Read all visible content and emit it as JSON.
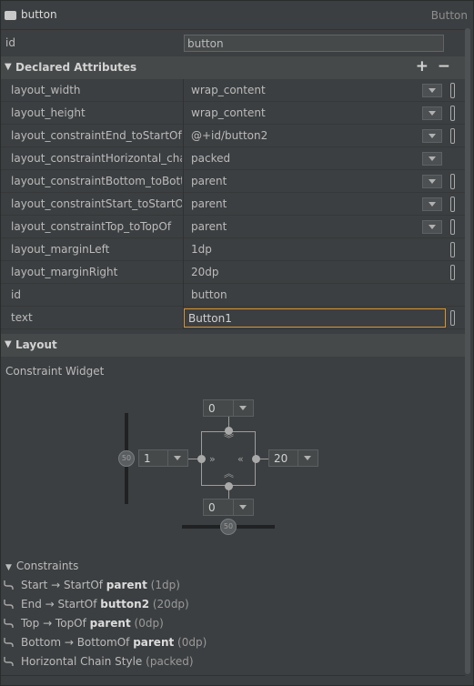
{
  "component": {
    "name": "button",
    "class_name": "Button"
  },
  "id_field": {
    "label": "id",
    "value": "button"
  },
  "declared_attributes": {
    "title": "Declared Attributes",
    "add": "+",
    "remove": "−",
    "rows": [
      {
        "name": "layout_width",
        "value": "wrap_content"
      },
      {
        "name": "layout_height",
        "value": "wrap_content"
      },
      {
        "name": "layout_constraintEnd_toStartOf",
        "value": "@+id/button2"
      },
      {
        "name": "layout_constraintHorizontal_chainStyle",
        "value": "packed"
      },
      {
        "name": "layout_constraintBottom_toBottomOf",
        "value": "parent"
      },
      {
        "name": "layout_constraintStart_toStartOf",
        "value": "parent"
      },
      {
        "name": "layout_constraintTop_toTopOf",
        "value": "parent"
      },
      {
        "name": "layout_marginLeft",
        "value": "1dp"
      },
      {
        "name": "layout_marginRight",
        "value": "20dp"
      },
      {
        "name": "id",
        "value": "button"
      },
      {
        "name": "text",
        "value": "Button1"
      }
    ]
  },
  "layout_section": {
    "title": "Layout",
    "subtitle": "Constraint Widget",
    "margins": {
      "top": "0",
      "left": "1",
      "right": "20",
      "bottom": "0"
    },
    "bias": {
      "vertical": "50",
      "horizontal": "50"
    }
  },
  "constraints": {
    "title": "Constraints",
    "items": [
      {
        "pre": "Start → StartOf ",
        "target": "parent",
        "post": " (1dp)"
      },
      {
        "pre": "End → StartOf ",
        "target": "button2",
        "post": " (20dp)"
      },
      {
        "pre": "Top → TopOf ",
        "target": "parent",
        "post": " (0dp)"
      },
      {
        "pre": "Bottom → BottomOf ",
        "target": "parent",
        "post": " (0dp)"
      },
      {
        "pre": "Horizontal Chain Style ",
        "target": "",
        "post": " (packed)"
      }
    ]
  },
  "icons": [
    "component-icon",
    "dropdown-icon",
    "resource-picker-icon",
    "constraint-icon",
    "chevron-icon"
  ]
}
